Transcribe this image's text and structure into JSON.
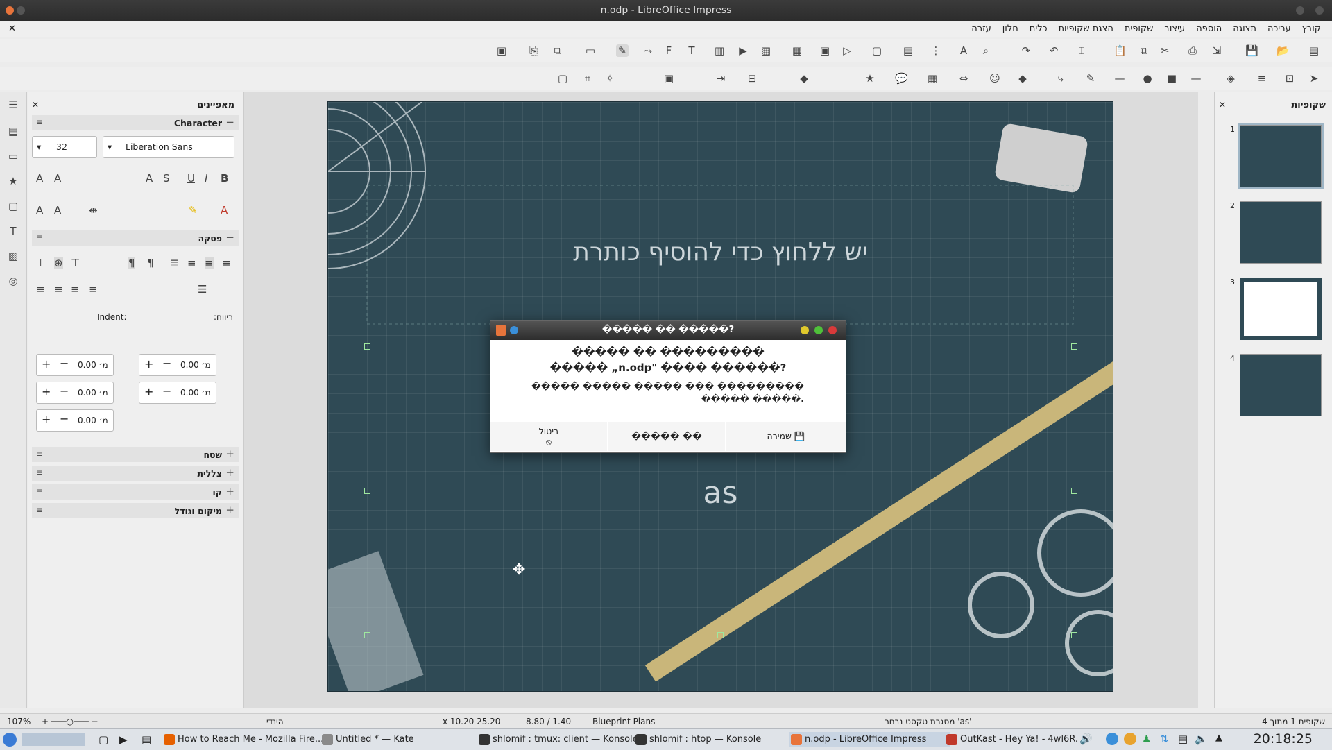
{
  "window": {
    "title": "n.odp - LibreOffice Impress"
  },
  "menu": [
    "קובץ",
    "עריכה",
    "תצוגה",
    "הוספה",
    "עיצוב",
    "שקופית",
    "הצגת שקופיות",
    "כלים",
    "חלון",
    "עזרה"
  ],
  "properties": {
    "title": "מאפיינים",
    "character": {
      "label": "Character",
      "font_size": "32",
      "font_name": "Liberation Sans"
    },
    "paragraph": {
      "label": "פסקה",
      "spacing_label": "ריווח:",
      "indent_label": "Indent:",
      "values": [
        "0.00 מ׳",
        "0.00 מ׳",
        "0.00 מ׳",
        "0.00 מ׳",
        "0.00 מ׳"
      ]
    },
    "sections": [
      "שטח",
      "צללית",
      "קו",
      "מיקום וגודל"
    ]
  },
  "slide": {
    "title_placeholder": "יש ללחוץ כדי להוסיף כותרת",
    "body_text": "as"
  },
  "dialog": {
    "title": "����� �� �����?",
    "message_line1": "����� �� ���������",
    "message_line2": "����� „n.odp\" ���� ������?",
    "detail": "����� ����� ����� ��� ��������� ����� �����.",
    "buttons": {
      "save": "שמירה",
      "dont_save": "����� ��",
      "cancel": "ביטול"
    }
  },
  "slides_pane": {
    "title": "שקופיות",
    "numbers": [
      "1",
      "2",
      "3",
      "4"
    ]
  },
  "status": {
    "zoom": "107%",
    "language": "הינדי",
    "position": "x 10.20 25.20",
    "size": "8.80 / 1.40",
    "master": "Blueprint Plans",
    "selection": "מסגרת טקסט נבחר 'as'",
    "slide_count": "שקופית 1 מתוך 4"
  },
  "taskbar": {
    "tasks": [
      {
        "label": "How to Reach Me - Mozilla Fire...",
        "color": "#e66000"
      },
      {
        "label": "Untitled * — Kate",
        "color": "#8a8a8a"
      },
      {
        "label": "shlomif : tmux: client — Konsole",
        "color": "#333333"
      },
      {
        "label": "shlomif : htop — Konsole",
        "color": "#333333"
      },
      {
        "label": "n.odp - LibreOffice Impress",
        "color": "#e8743b"
      },
      {
        "label": "OutKast - Hey Ya! - 4wl6R...",
        "color": "#c0392b"
      }
    ],
    "clock": "20:18:25"
  }
}
